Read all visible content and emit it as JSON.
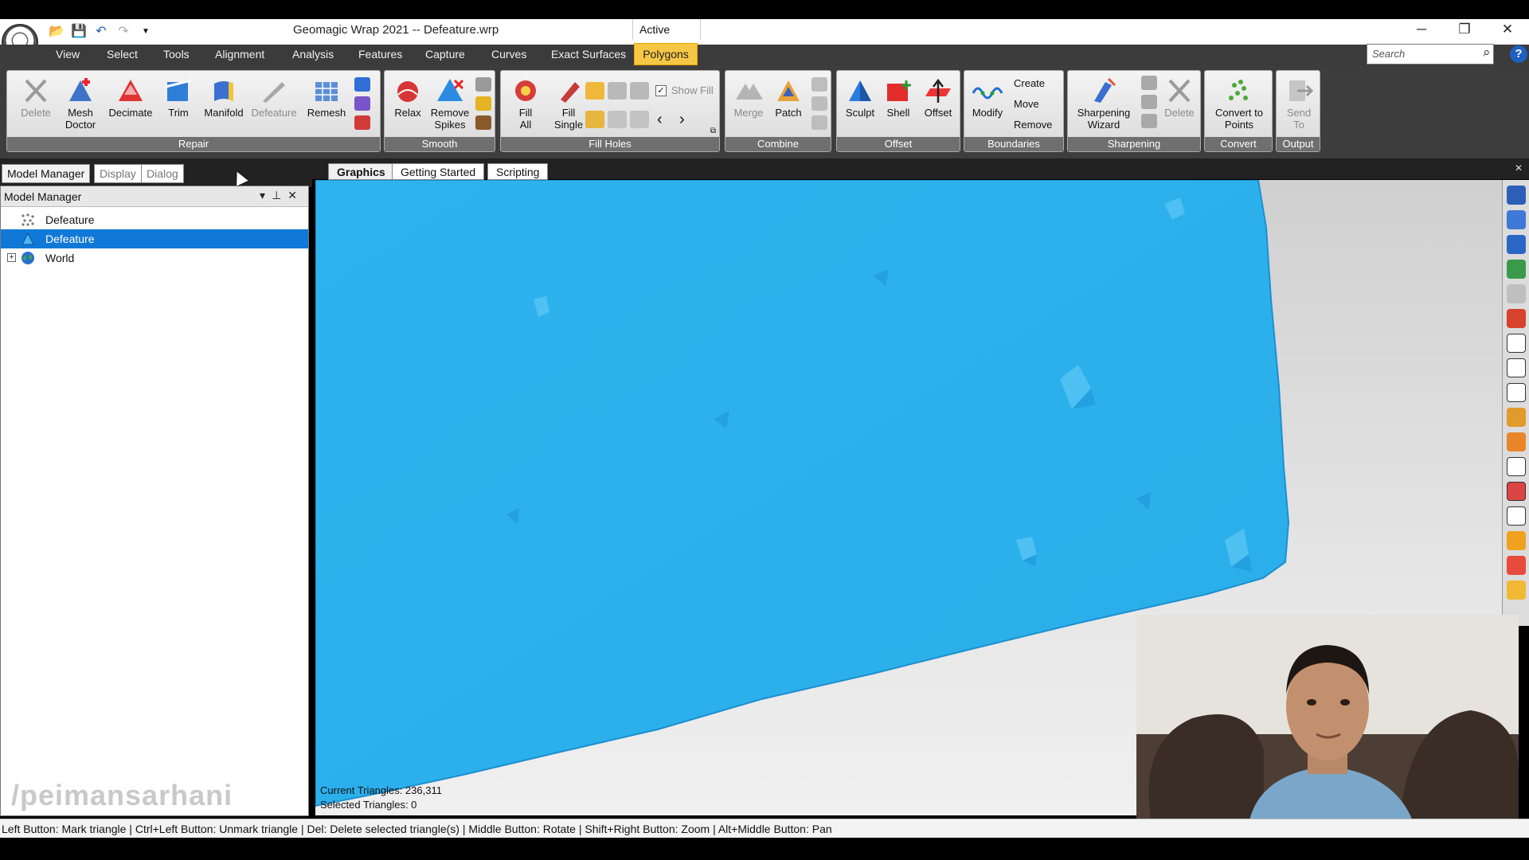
{
  "window": {
    "title": "Geomagic Wrap 2021 -- Defeature.wrp",
    "active_label": "Active",
    "controls": [
      "minimize",
      "restore",
      "close"
    ]
  },
  "quick_access": [
    "open-icon",
    "save-icon",
    "undo-icon",
    "redo-icon",
    "dropdown-icon"
  ],
  "menu": {
    "items": [
      "View",
      "Select",
      "Tools",
      "Alignment",
      "Analysis",
      "Features",
      "Capture",
      "Curves",
      "Exact Surfaces"
    ],
    "active": "Polygons"
  },
  "search": {
    "placeholder": "Search"
  },
  "ribbon": {
    "repair": {
      "label": "Repair",
      "tools": [
        {
          "label": "Delete",
          "icon": "delete-icon"
        },
        {
          "label": "Mesh Doctor",
          "icon": "mesh-doctor-icon"
        },
        {
          "label": "Decimate",
          "icon": "decimate-icon"
        },
        {
          "label": "Trim",
          "icon": "trim-icon"
        },
        {
          "label": "Manifold",
          "icon": "manifold-icon"
        },
        {
          "label": "Defeature",
          "icon": "defeature-icon"
        },
        {
          "label": "Remesh",
          "icon": "remesh-icon"
        }
      ]
    },
    "smooth": {
      "label": "Smooth",
      "tools": [
        {
          "label": "Relax"
        },
        {
          "label": "Remove Spikes"
        }
      ]
    },
    "fill_holes": {
      "label": "Fill Holes",
      "tools": [
        {
          "label": "Fill All"
        },
        {
          "label": "Fill Single"
        }
      ],
      "show_fill": "Show Fill"
    },
    "combine": {
      "label": "Combine",
      "tools": [
        {
          "label": "Merge"
        },
        {
          "label": "Patch"
        }
      ]
    },
    "offset": {
      "label": "Offset",
      "tools": [
        {
          "label": "Sculpt"
        },
        {
          "label": "Shell"
        },
        {
          "label": "Offset"
        }
      ]
    },
    "boundaries": {
      "label": "Boundaries",
      "modify": "Modify",
      "create": "Create",
      "move": "Move",
      "remove": "Remove"
    },
    "sharpening": {
      "label": "Sharpening",
      "tools": [
        {
          "label": "Sharpening Wizard"
        },
        {
          "label": "Delete"
        }
      ]
    },
    "convert": {
      "label": "Convert",
      "tools": [
        {
          "label": "Convert to Points"
        }
      ]
    },
    "output": {
      "label": "Output",
      "tools": [
        {
          "label": "Send To"
        }
      ]
    }
  },
  "panel_tabs": [
    "Model Manager",
    "Display",
    "Dialog"
  ],
  "model_manager": {
    "title": "Model Manager",
    "items": [
      {
        "label": "Defeature",
        "icon": "point-cloud-icon",
        "selected": false
      },
      {
        "label": "Defeature",
        "icon": "mesh-icon",
        "selected": true
      },
      {
        "label": "World",
        "icon": "globe-icon",
        "selected": false
      }
    ]
  },
  "view_tabs": [
    "Graphics",
    "Getting Started",
    "Scripting"
  ],
  "stats": {
    "current_triangles": "Current Triangles: 236,311",
    "selected_triangles": "Selected Triangles: 0"
  },
  "watermark": "/peimansarhani",
  "status_bar": "Left Button: Mark triangle | Ctrl+Left Button: Unmark triangle | Del: Delete selected triangle(s) | Middle Button: Rotate | Shift+Right Button: Zoom | Alt+Middle Button: Pan",
  "colors": {
    "mesh": "#2fb3ee",
    "menu_active": "#f6c744",
    "selection": "#1079d8"
  }
}
